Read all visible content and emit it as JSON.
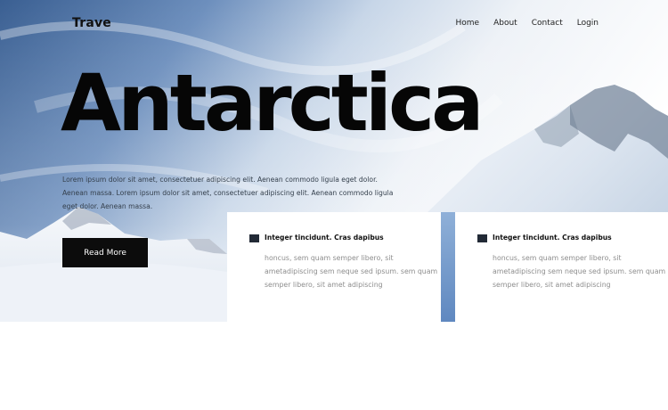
{
  "header": {
    "logo": "Trave",
    "nav": [
      "Home",
      "About",
      "Contact",
      "Login"
    ]
  },
  "hero": {
    "title": "Antarctica",
    "intro": "Lorem ipsum dolor sit amet, consectetuer adipiscing elit. Aenean commodo ligula eget dolor. Aenean massa. Lorem ipsum dolor sit amet, consectetuer adipiscing elit. Aenean commodo ligula eget dolor. Aenean massa.",
    "cta_label": "Read More"
  },
  "cards": [
    {
      "title": "Integer tincidunt. Cras dapibus",
      "body": "honcus, sem quam semper libero, sit ametadipiscing sem neque sed ipsum. sem quam semper libero, sit amet adipiscing"
    },
    {
      "title": "Integer tincidunt. Cras dapibus",
      "body": "honcus, sem quam semper libero, sit ametadipiscing sem neque sed ipsum. sem quam semper libero, sit amet adipiscing"
    }
  ],
  "colors": {
    "sky_deep": "#3f6596",
    "sky_light": "#e9eef5",
    "snow": "#f3f6fa",
    "text_dark": "#060606",
    "button_bg": "#0c0c0c"
  }
}
